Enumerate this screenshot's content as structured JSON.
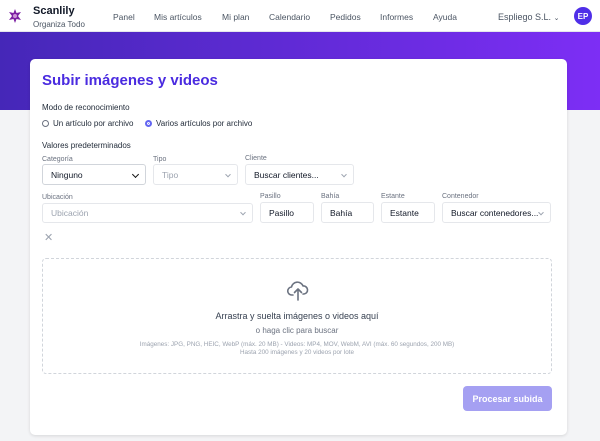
{
  "header": {
    "brand": "Scanlily",
    "tagline": "Organiza Todo",
    "nav": [
      "Panel",
      "Mis artículos",
      "Mi plan",
      "Calendario",
      "Pedidos",
      "Informes",
      "Ayuda"
    ],
    "org": "Espliego S.L.",
    "avatar": "EP",
    "accent": "#4f2ee8"
  },
  "card": {
    "title": "Subir imágenes y videos",
    "mode": {
      "label": "Modo de reconocimiento",
      "options": [
        "Un artículo por archivo",
        "Varios artículos por archivo"
      ],
      "selected": "Varios artículos por archivo"
    },
    "defaults": {
      "label": "Valores predeterminados",
      "categoria": {
        "label": "Categoría",
        "value": "Ninguno"
      },
      "tipo": {
        "label": "Tipo",
        "placeholder": "Tipo"
      },
      "cliente": {
        "label": "Cliente",
        "placeholder": "Buscar clientes..."
      },
      "ubicacion": {
        "label": "Ubicación",
        "placeholder": "Ubicación"
      },
      "pasillo": {
        "label": "Pasillo",
        "placeholder": "Pasillo"
      },
      "bahia": {
        "label": "Bahía",
        "placeholder": "Bahía"
      },
      "estante": {
        "label": "Estante",
        "placeholder": "Estante"
      },
      "contenedor": {
        "label": "Contenedor",
        "placeholder": "Buscar contenedores..."
      }
    },
    "dropzone": {
      "title": "Arrastra y suelta imágenes o videos aquí",
      "subtitle": "o haga clic para buscar",
      "formats": "Imágenes: JPG, PNG, HEIC, WebP (máx. 20 MB) - Videos: MP4, MOV, WebM, AVI (máx. 60 segundos, 200 MB)",
      "limits": "Hasta 200 imágenes y 20 videos por lote"
    },
    "submit": "Procesar subida"
  }
}
